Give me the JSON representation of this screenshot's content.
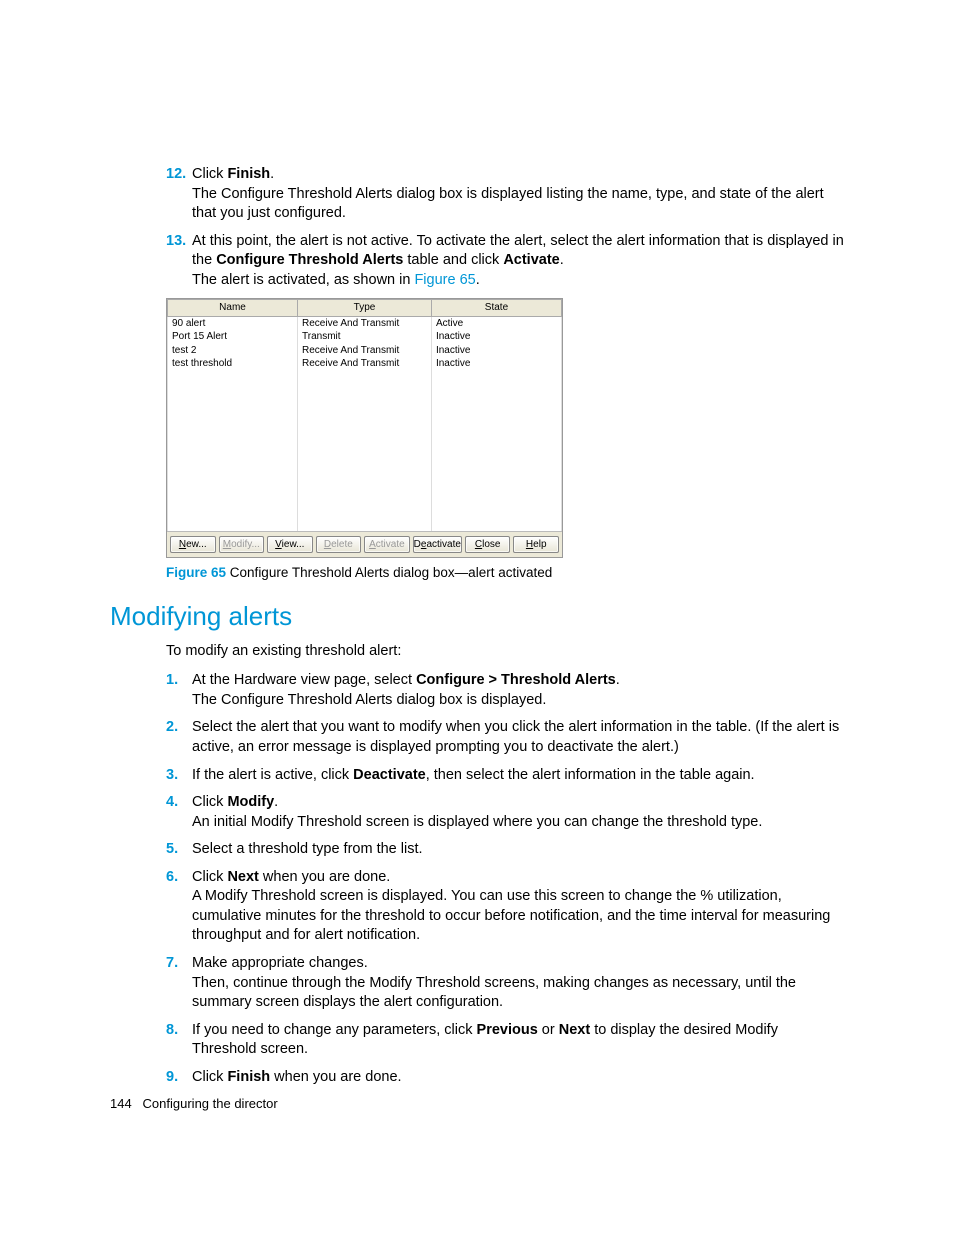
{
  "steps_top": [
    {
      "num": "12.",
      "parts": [
        "Click ",
        {
          "b": "Finish"
        },
        "."
      ],
      "after": "The Configure Threshold Alerts dialog box is displayed listing the name, type, and state of the alert that you just configured."
    },
    {
      "num": "13.",
      "parts": [
        "At this point, the alert is not active. To activate the alert, select the alert information that is displayed in the ",
        {
          "b": "Configure Threshold Alerts"
        },
        " table and click ",
        {
          "b": "Activate"
        },
        "."
      ],
      "after_parts": [
        "The alert is activated, as shown in ",
        {
          "l": "Figure 65"
        },
        "."
      ]
    }
  ],
  "dialog": {
    "headers": [
      "Name",
      "Type",
      "State"
    ],
    "rows": [
      {
        "name": "90 alert",
        "type": "Receive And Transmit",
        "state": "Active"
      },
      {
        "name": "Port 15 Alert",
        "type": "Transmit",
        "state": "Inactive"
      },
      {
        "name": "test 2",
        "type": "Receive And Transmit",
        "state": "Inactive"
      },
      {
        "name": "test threshold",
        "type": "Receive And Transmit",
        "state": "Inactive"
      }
    ],
    "buttons": [
      {
        "label": "New...",
        "u": "N",
        "disabled": false
      },
      {
        "label": "Modify...",
        "u": "M",
        "disabled": true
      },
      {
        "label": "View...",
        "u": "V",
        "disabled": false
      },
      {
        "label": "Delete",
        "u": "D",
        "disabled": true
      },
      {
        "label": "Activate",
        "u": "A",
        "disabled": true
      },
      {
        "label": "Deactivate",
        "u": "e",
        "disabled": false
      },
      {
        "label": "Close",
        "u": "C",
        "disabled": false
      },
      {
        "label": "Help",
        "u": "H",
        "disabled": false
      }
    ]
  },
  "figure": {
    "label": "Figure 65",
    "caption": "Configure Threshold Alerts dialog box—alert activated"
  },
  "section_title": "Modifying alerts",
  "intro": "To modify an existing threshold alert:",
  "steps_bottom": [
    {
      "num": "1.",
      "parts": [
        "At the Hardware view page, select ",
        {
          "b": "Configure > Threshold Alerts"
        },
        "."
      ],
      "after": "The Configure Threshold Alerts dialog box is displayed."
    },
    {
      "num": "2.",
      "parts": [
        "Select the alert that you want to modify when you click the alert information in the table. (If the alert is active, an error message is displayed prompting you to deactivate the alert.)"
      ]
    },
    {
      "num": "3.",
      "parts": [
        "If the alert is active, click ",
        {
          "b": "Deactivate"
        },
        ", then select the alert information in the table again."
      ]
    },
    {
      "num": "4.",
      "parts": [
        "Click ",
        {
          "b": "Modify"
        },
        "."
      ],
      "after": "An initial Modify Threshold screen is displayed where you can change the threshold type."
    },
    {
      "num": "5.",
      "parts": [
        "Select a threshold type from the list."
      ]
    },
    {
      "num": "6.",
      "parts": [
        "Click ",
        {
          "b": "Next"
        },
        " when you are done."
      ],
      "after": "A Modify Threshold screen is displayed. You can use this screen to change the % utilization, cumulative minutes for the threshold to occur before notification, and the time interval for measuring throughput and for alert notification."
    },
    {
      "num": "7.",
      "parts": [
        "Make appropriate changes."
      ],
      "after": "Then, continue through the Modify Threshold screens, making changes as necessary, until the summary screen displays the alert configuration."
    },
    {
      "num": "8.",
      "parts": [
        "If you need to change any parameters, click ",
        {
          "b": "Previous"
        },
        " or ",
        {
          "b": "Next"
        },
        " to display the desired Modify Threshold screen."
      ]
    },
    {
      "num": "9.",
      "parts": [
        "Click ",
        {
          "b": "Finish"
        },
        " when you are done."
      ]
    }
  ],
  "footer": {
    "page": "144",
    "chapter": "Configuring the director"
  }
}
